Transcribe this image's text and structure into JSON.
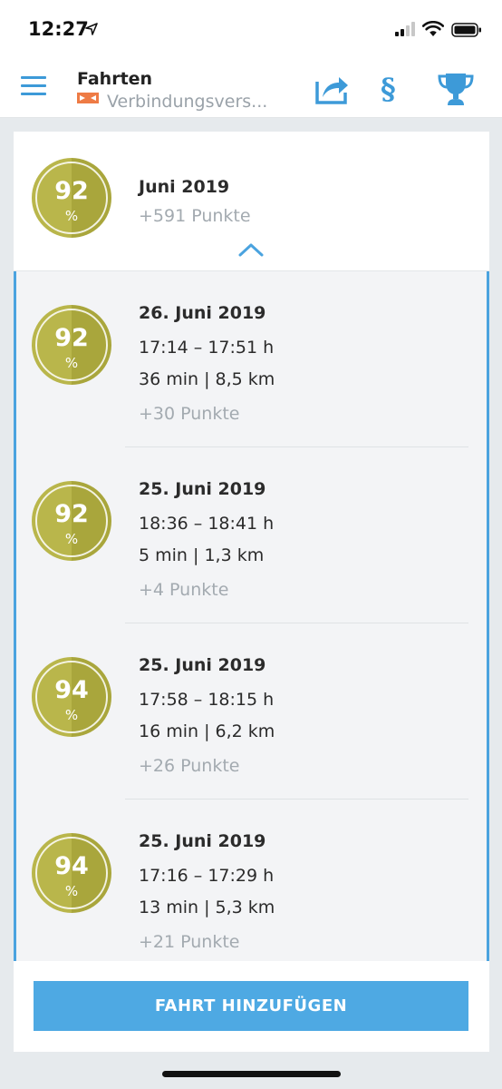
{
  "status_bar": {
    "time": "12:27"
  },
  "header": {
    "title": "Fahrten",
    "subtitle": "Verbindungsvers...",
    "accent_color": "#3d9ad8",
    "icons": [
      "menu-icon",
      "share-icon",
      "paragraph-icon",
      "trophy-icon"
    ],
    "paragraph_symbol": "§"
  },
  "month": {
    "score": "92",
    "score_unit": "%",
    "title": "Juni 2019",
    "points": "+591 Punkte"
  },
  "trips": [
    {
      "score": "92",
      "unit": "%",
      "date": "26. Juni 2019",
      "time": "17:14 – 17:51 h",
      "distance": "36 min | 8,5 km",
      "points": "+30 Punkte"
    },
    {
      "score": "92",
      "unit": "%",
      "date": "25. Juni 2019",
      "time": "18:36 – 18:41 h",
      "distance": "5 min | 1,3 km",
      "points": "+4 Punkte"
    },
    {
      "score": "94",
      "unit": "%",
      "date": "25. Juni 2019",
      "time": "17:58 – 18:15 h",
      "distance": "16 min | 6,2 km",
      "points": "+26 Punkte"
    },
    {
      "score": "94",
      "unit": "%",
      "date": "25. Juni 2019",
      "time": "17:16 – 17:29 h",
      "distance": "13 min | 5,3 km",
      "points": "+21 Punkte"
    }
  ],
  "footer": {
    "add_button": "FAHRT HINZUFÜGEN",
    "button_color": "#4ea9e3"
  },
  "colors": {
    "score_badge": "#b9b64b",
    "score_badge_dark": "#a9a63c",
    "muted_text": "#a3aab0"
  }
}
